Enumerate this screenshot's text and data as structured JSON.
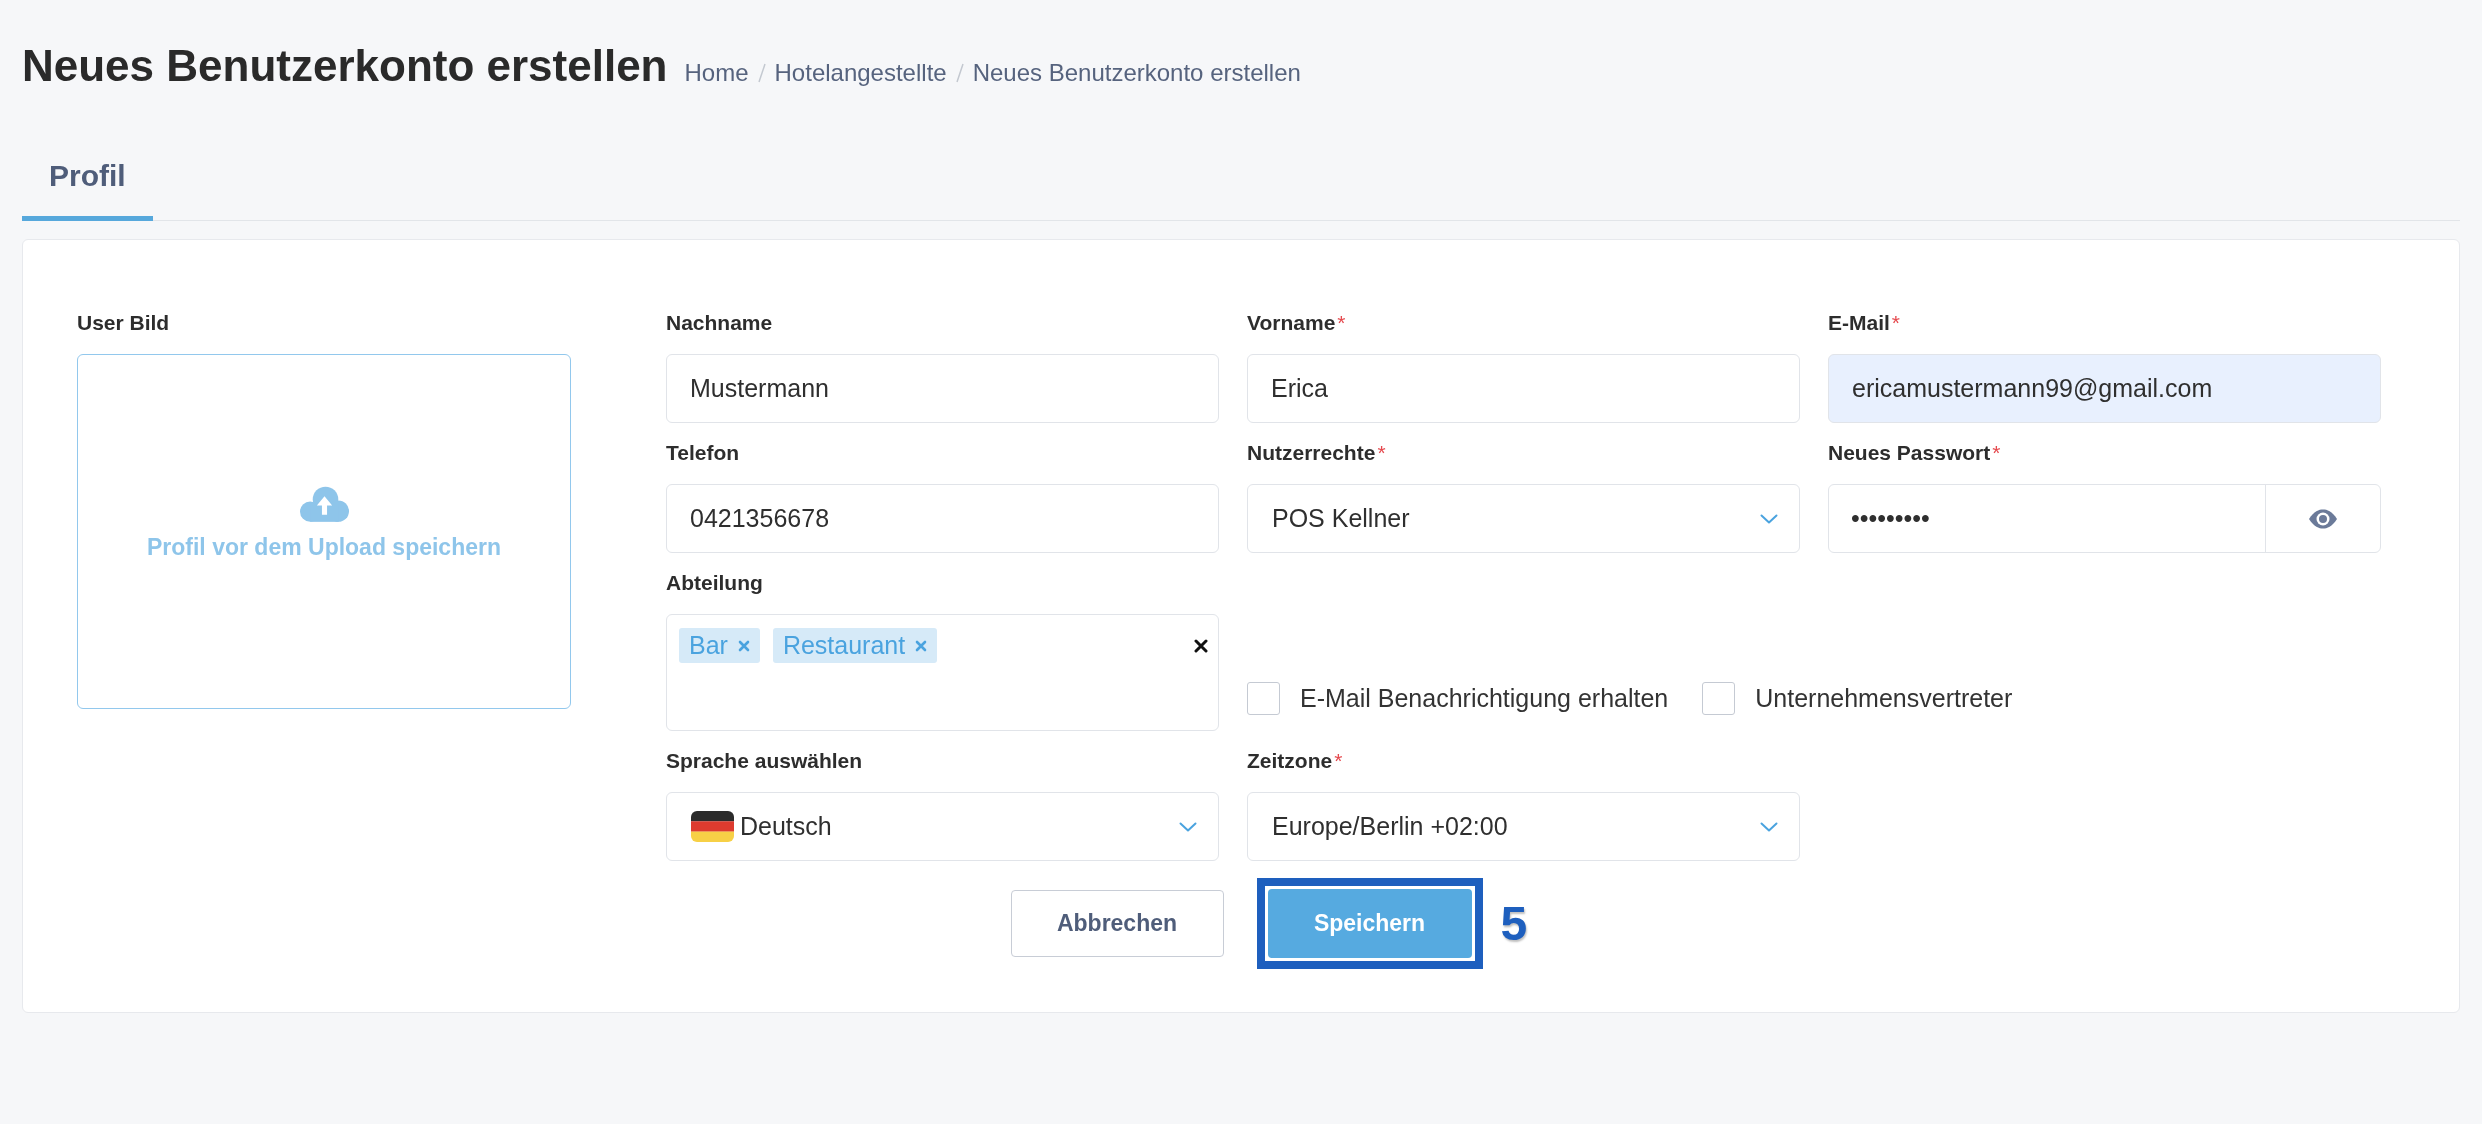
{
  "header": {
    "title": "Neues Benutzerkonto erstellen",
    "breadcrumb": [
      {
        "label": "Home"
      },
      {
        "label": "Hotelangestellte"
      },
      {
        "label": "Neues Benutzerkonto erstellen"
      }
    ]
  },
  "tabs": [
    {
      "label": "Profil",
      "selected": true
    }
  ],
  "photo_upload": {
    "label": "User Bild",
    "hint": "Profil vor dem Upload speichern"
  },
  "fields": [
    {
      "kind": "text",
      "label": "Nachname",
      "value": "Mustermann",
      "autofilled": false
    },
    {
      "kind": "text",
      "label": "Vorname",
      "required_mark": "*",
      "value": "Erica",
      "autofilled": false
    },
    {
      "kind": "text",
      "label": "E-Mail",
      "required_mark": "*",
      "value": "ericamustermann99@gmail.com",
      "autofilled": true
    },
    {
      "kind": "text",
      "label": "Telefon",
      "value": "0421356678",
      "autofilled": false
    },
    {
      "kind": "select",
      "label": "Nutzerrechte",
      "required_mark": "*",
      "value": "POS Kellner"
    },
    {
      "kind": "password",
      "label": "Neues Passwort",
      "required_mark": "*",
      "value": "•••••••••"
    },
    {
      "kind": "tags",
      "label": "Abteilung",
      "tags": [
        {
          "label": "Bar"
        },
        {
          "label": "Restaurant"
        }
      ]
    },
    {
      "kind": "checkboxes",
      "options": [
        {
          "label": "E-Mail Benachrichtigung erhalten",
          "checked": false
        },
        {
          "label": "Unternehmensvertreter",
          "checked": false
        }
      ]
    },
    {
      "kind": "language",
      "label": "Sprache auswählen",
      "value": "Deutsch"
    },
    {
      "kind": "select",
      "label": "Zeitzone",
      "required_mark": "*",
      "value": "Europe/Berlin +02:00"
    }
  ],
  "actions": [
    {
      "kind": "secondary",
      "label": "Abbrechen",
      "highlighted": false
    },
    {
      "kind": "primary",
      "label": "Speichern",
      "highlighted": true
    }
  ],
  "annotation": {
    "label": "5"
  }
}
